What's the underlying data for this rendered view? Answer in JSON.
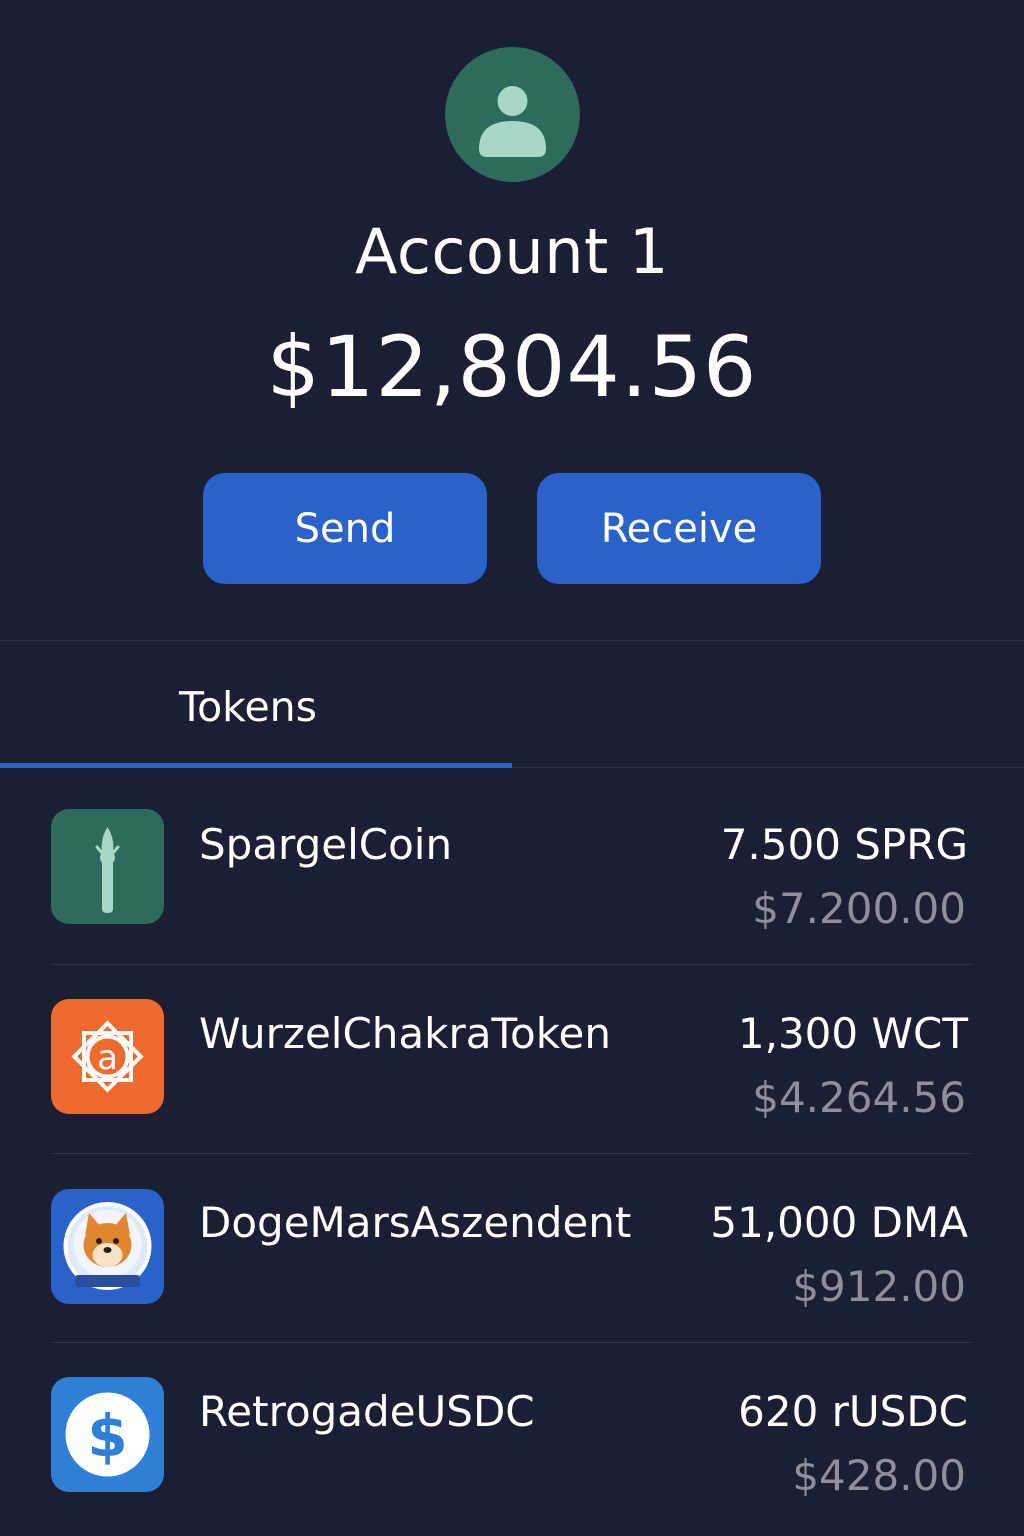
{
  "account": {
    "name": "Account 1",
    "balance": "$12,804.56",
    "avatar_icon": "user-avatar-icon"
  },
  "actions": {
    "send_label": "Send",
    "receive_label": "Receive"
  },
  "tabs": [
    {
      "label": "Tokens",
      "active": true
    }
  ],
  "tokens": [
    {
      "name": "SpargelCoin",
      "amount": "7.500 SPRG",
      "value": "$7.200.00",
      "icon": "asparagus-icon",
      "icon_bg": "#2f6b5c"
    },
    {
      "name": "WurzelChakraToken",
      "amount": "1,300 WCT",
      "value": "$4.264.56",
      "icon": "root-chakra-icon",
      "icon_bg": "#ef6a2e"
    },
    {
      "name": "DogeMarsAszendent",
      "amount": "51,000 DMA",
      "value": "$912.00",
      "icon": "doge-astronaut-icon",
      "icon_bg": "#2a62c9"
    },
    {
      "name": "RetrogadeUSDC",
      "amount": "620 rUSDC",
      "value": "$428.00",
      "icon": "dollar-coin-icon",
      "icon_bg": "#2f7fd6"
    }
  ],
  "colors": {
    "background": "#1b1f33",
    "accent": "#2a62c9",
    "muted_text": "#8d8f9c",
    "divider": "#343a52"
  }
}
